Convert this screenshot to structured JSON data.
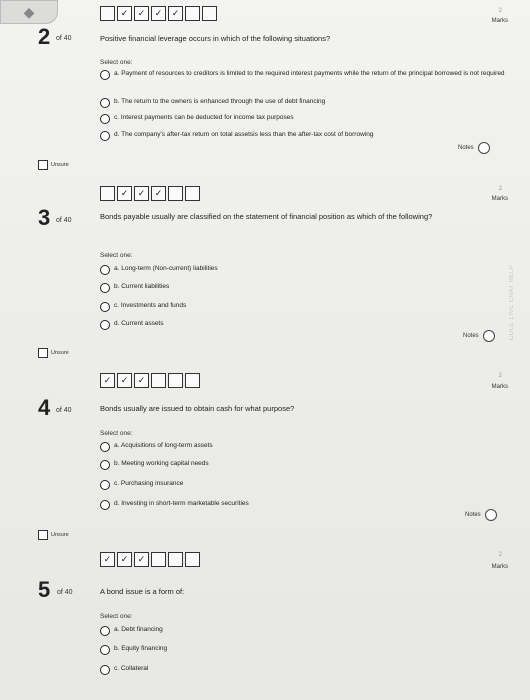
{
  "side_label": "COLE LIVE CHAT HELP",
  "question_mark_glyph": "✓",
  "questions": [
    {
      "num": "2",
      "of": "of 40",
      "marks_num": "2",
      "marks_label": "Marks",
      "squares": [
        "",
        "✓",
        "✓",
        "✓",
        "✓",
        "",
        ""
      ],
      "text": "Positive financial leverage occurs in which of the following situations?",
      "select_one": "Select one:",
      "options": [
        "a. Payment of resources to creditors is limited to the required interest payments while the return of the principal borrowed is not required",
        "b. The return to the owners is enhanced through the use of debt financing",
        "c. Interest payments can be deducted for income tax purposes",
        "d. The company's after-tax return on total assetsis less than the after-tax cost of borrowing"
      ],
      "notes": "Notes",
      "unsure": "Unsure"
    },
    {
      "num": "3",
      "of": "of 40",
      "marks_num": "2",
      "marks_label": "Marks",
      "squares": [
        "",
        "✓",
        "✓",
        "✓",
        "",
        ""
      ],
      "text": "Bonds payable usually are classified on the statement of financial position as which of the following?",
      "select_one": "Select one:",
      "options": [
        "a. Long-term (Non-current) liabilities",
        "b. Current liabilities",
        "c. Investments and funds",
        "d. Current assets"
      ],
      "notes": "Notes",
      "unsure": "Unsure"
    },
    {
      "num": "4",
      "of": "of 40",
      "marks_num": "2",
      "marks_label": "Marks",
      "squares": [
        "✓",
        "✓",
        "✓",
        "",
        "",
        ""
      ],
      "text": "Bonds usually are issued to obtain cash for what purpose?",
      "select_one": "Select one:",
      "options": [
        "a. Acquisitions of long-term assets",
        "b. Meeting working capital needs",
        "c. Purchasing insurance",
        "d. Investing in short-term marketable securities"
      ],
      "notes": "Notes",
      "unsure": "Unsure"
    },
    {
      "num": "5",
      "of": "of 40",
      "marks_num": "2",
      "marks_label": "Marks",
      "squares": [
        "✓",
        "✓",
        "✓",
        "",
        "",
        ""
      ],
      "text": "A bond issue is a form of:",
      "select_one": "Select one:",
      "options": [
        "a. Debt financing",
        "b. Equity financing",
        "c. Collateral"
      ]
    }
  ]
}
